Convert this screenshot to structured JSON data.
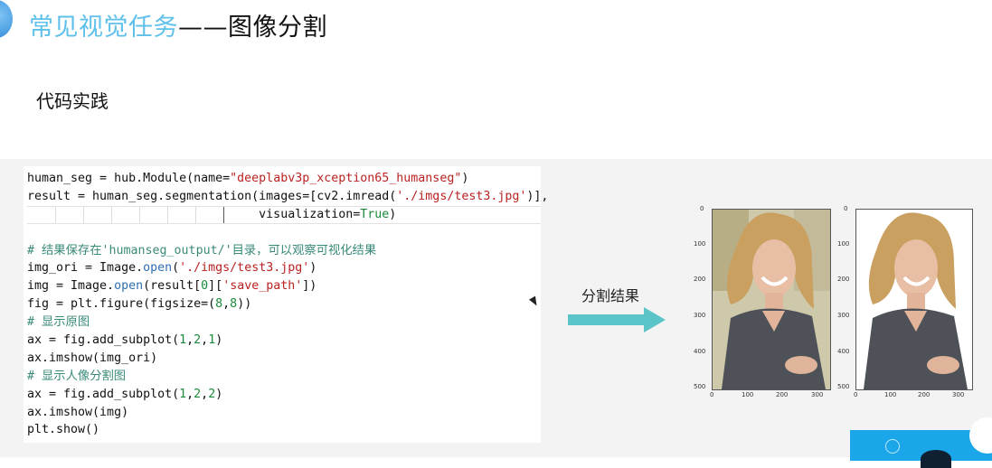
{
  "slide": {
    "title_accent": "常见视觉任务",
    "title_rest": "——图像分割",
    "subtitle": "代码实践",
    "result_label": "分割结果"
  },
  "code_lines": [
    "human_seg = hub.Module(name=\"deeplabv3p_xception65_humanseg\")",
    "result = human_seg.segmentation(images=[cv2.imread('./imgs/test3.jpg')],",
    "                                visualization=True)",
    "",
    "# 结果保存在'humanseg_output/'目录，可以观察可视化结果",
    "img_ori = Image.open('./imgs/test3.jpg')",
    "img = Image.open(result[0]['save_path'])",
    "fig = plt.figure(figsize=(8,8))",
    "# 显示原图",
    "ax = fig.add_subplot(1,2,1)",
    "ax.imshow(img_ori)",
    "# 显示人像分割图",
    "ax = fig.add_subplot(1,2,2)",
    "ax.imshow(img)",
    "plt.show()"
  ],
  "plots": {
    "y_ticks": [
      "0",
      "100",
      "200",
      "300",
      "400",
      "500"
    ],
    "x_ticks": [
      "0",
      "100",
      "200",
      "300"
    ],
    "left_image": "original photo: smiling woman with long wavy blond hair, grey top",
    "right_image": "segmented portrait on white background"
  },
  "colors": {
    "title_accent": "#5fc0ea",
    "arrow": "#5bc4c8",
    "band": "#f3f3f3",
    "corner_blue": "#1aa6e8"
  }
}
